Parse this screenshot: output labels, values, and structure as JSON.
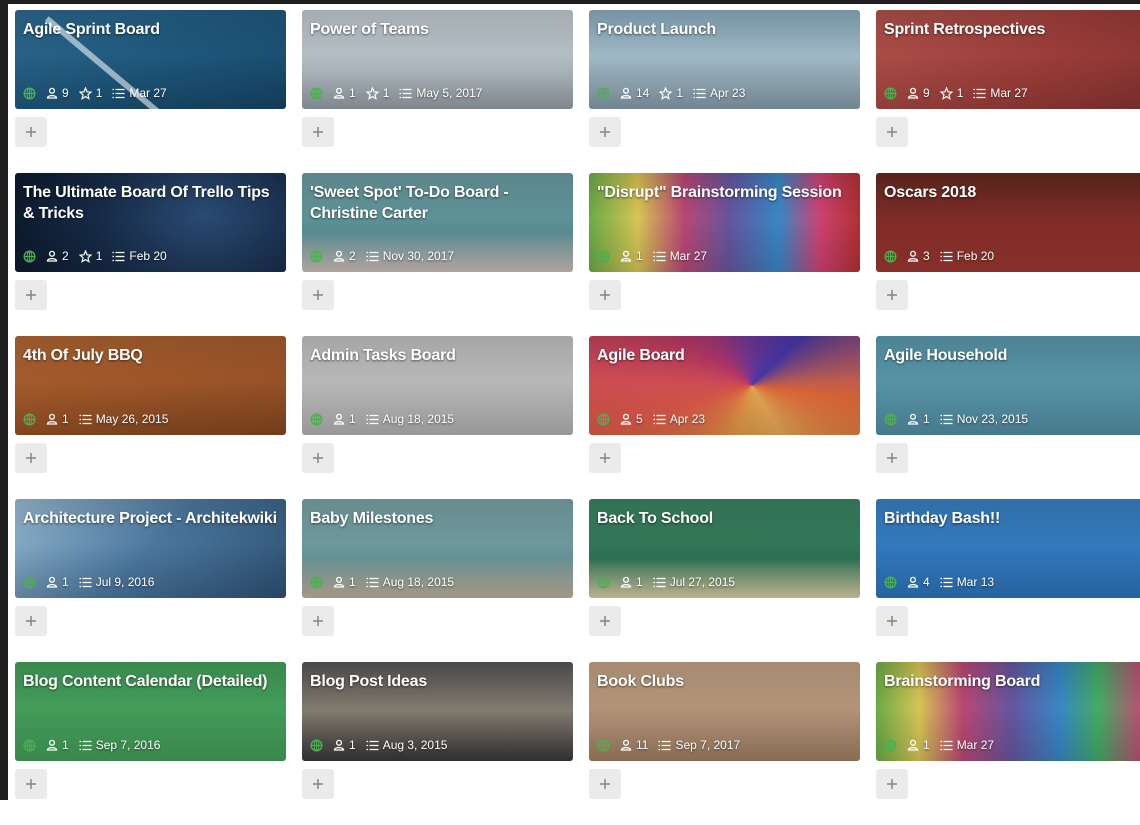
{
  "boards": [
    {
      "title": "Agile Sprint Board",
      "members": "9",
      "stars": "1",
      "date": "Mar 27",
      "bg": "sprint",
      "icon": "globe"
    },
    {
      "title": "Power of Teams",
      "members": "1",
      "stars": "1",
      "date": "May 5, 2017",
      "bg": "teams",
      "icon": "globe"
    },
    {
      "title": "Product Launch",
      "members": "14",
      "stars": "1",
      "date": "Apr 23",
      "bg": "launch",
      "icon": "globe"
    },
    {
      "title": "Sprint Retrospectives",
      "members": "9",
      "stars": "1",
      "date": "Mar 27",
      "bg": "retro",
      "icon": "globe"
    },
    {
      "title": "The Ultimate Board Of Trello Tips & Tricks",
      "members": "2",
      "stars": "1",
      "date": "Feb 20",
      "bg": "trello",
      "icon": "globe"
    },
    {
      "title": "'Sweet Spot' To-Do Board - Christine Carter",
      "members": "2",
      "stars": "",
      "date": "Nov 30, 2017",
      "bg": "sweet",
      "icon": "globe"
    },
    {
      "title": "\"Disrupt\" Brainstorming Session",
      "members": "1",
      "stars": "",
      "date": "Mar 27",
      "bg": "disrupt",
      "icon": "globe"
    },
    {
      "title": "Oscars 2018",
      "members": "3",
      "stars": "",
      "date": "Feb 20",
      "bg": "oscars",
      "icon": "globe"
    },
    {
      "title": "4th Of July BBQ",
      "members": "1",
      "stars": "",
      "date": "May 26, 2015",
      "bg": "bbq",
      "icon": "globe"
    },
    {
      "title": "Admin Tasks Board",
      "members": "1",
      "stars": "",
      "date": "Aug 18, 2015",
      "bg": "admin",
      "icon": "globe"
    },
    {
      "title": "Agile Board",
      "members": "5",
      "stars": "",
      "date": "Apr 23",
      "bg": "agile",
      "icon": "globe"
    },
    {
      "title": "Agile Household",
      "members": "1",
      "stars": "",
      "date": "Nov 23, 2015",
      "bg": "household",
      "icon": "globe"
    },
    {
      "title": "Architecture Project - Architekwiki",
      "members": "1",
      "stars": "",
      "date": "Jul 9, 2016",
      "bg": "arch",
      "icon": "globe"
    },
    {
      "title": "Baby Milestones",
      "members": "1",
      "stars": "",
      "date": "Aug 18, 2015",
      "bg": "baby",
      "icon": "globe"
    },
    {
      "title": "Back To School",
      "members": "1",
      "stars": "",
      "date": "Jul 27, 2015",
      "bg": "school",
      "icon": "globe"
    },
    {
      "title": "Birthday Bash!!",
      "members": "4",
      "stars": "",
      "date": "Mar 13",
      "bg": "birthday",
      "icon": "globe"
    },
    {
      "title": "Blog Content Calendar (Detailed)",
      "members": "1",
      "stars": "",
      "date": "Sep 7, 2016",
      "bg": "blog",
      "icon": "globe"
    },
    {
      "title": "Blog Post Ideas",
      "members": "1",
      "stars": "",
      "date": "Aug 3, 2015",
      "bg": "ideas",
      "icon": "globe"
    },
    {
      "title": "Book Clubs",
      "members": "11",
      "stars": "",
      "date": "Sep 7, 2017",
      "bg": "book",
      "icon": "globe"
    },
    {
      "title": "Brainstorming Board",
      "members": "1",
      "stars": "",
      "date": "Mar 27",
      "bg": "brain",
      "icon": "globe"
    }
  ],
  "colors": {
    "globe_icon": "#4caf50",
    "add_button_bg": "#ebebeb",
    "add_icon": "#8a8a8a",
    "title_text": "#ffffff"
  },
  "add_button_label": "+"
}
